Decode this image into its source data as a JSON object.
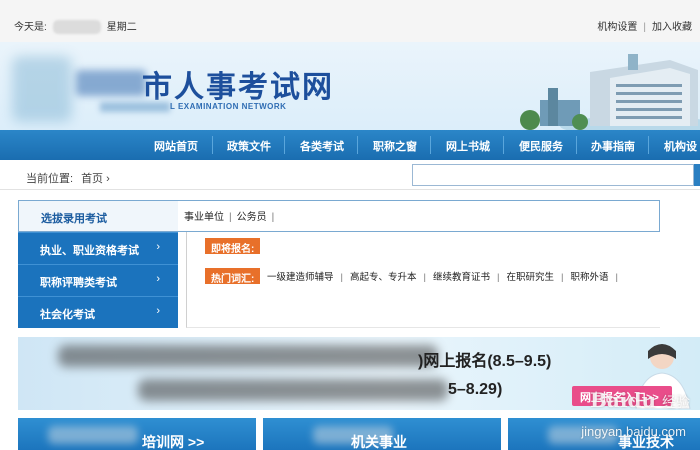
{
  "topbar": {
    "today_label": "今天是:",
    "weekday": "星期二",
    "links": [
      "机构设置",
      "加入收藏"
    ]
  },
  "header": {
    "title_visible": "市人事考试网",
    "subtitle_visible": "L EXAMINATION NETWORK"
  },
  "nav": {
    "items": [
      "网站首页",
      "政策文件",
      "各类考试",
      "职称之窗",
      "网上书城",
      "便民服务",
      "办事指南",
      "机构设"
    ]
  },
  "breadcrumb": {
    "label": "当前位置:",
    "current": "首页",
    "chevron": "›"
  },
  "search": {
    "placeholder": ""
  },
  "menu": {
    "items": [
      {
        "label": "选拔录用考试",
        "active": true
      },
      {
        "label": "执业、职业资格考试",
        "arrow": "›"
      },
      {
        "label": "职称评聘类考试",
        "arrow": "›"
      },
      {
        "label": "社会化考试",
        "arrow": "›"
      }
    ]
  },
  "submenu": {
    "items": [
      "事业单位",
      "公务员"
    ]
  },
  "panel": {
    "tag_upcoming": "即将报名:",
    "tag_hot": "热门词汇:",
    "hot_words": [
      "一级建造师辅导",
      "高起专、专升本",
      "继续教育证书",
      "在职研究生",
      "职称外语"
    ]
  },
  "banner": {
    "line1_visible": ")网上报名(8.5–9.5)",
    "line2_visible": "5–8.29)",
    "cta": "网上报名入口>>"
  },
  "cards": [
    {
      "text": "培训网 >>"
    },
    {
      "text": "机关事业"
    },
    {
      "text": "事业技术"
    }
  ],
  "watermark": {
    "logo": "Baidu",
    "logo_cn": "经验",
    "url": "jingyan.baidu.com"
  },
  "colors": {
    "nav_blue": "#1a6db0",
    "menu_blue": "#1b73bd",
    "tag_orange": "#e8702a",
    "cta_pink": "#e94d8a",
    "title_blue": "#1d4f9c"
  }
}
